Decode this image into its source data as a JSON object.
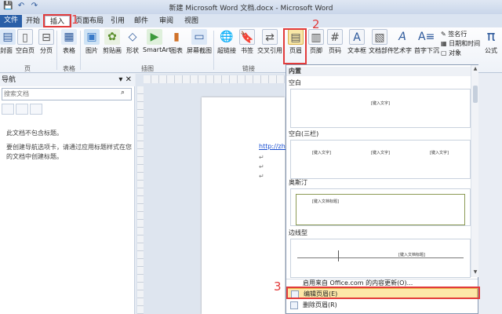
{
  "window": {
    "title": "新建 Microsoft Word 文档.docx - Microsoft Word"
  },
  "qat": [
    "💾",
    "↶",
    "↷"
  ],
  "tabs": [
    {
      "label": "文件"
    },
    {
      "label": "开始"
    },
    {
      "label": "插入"
    },
    {
      "label": "页面布局"
    },
    {
      "label": "引用"
    },
    {
      "label": "邮件"
    },
    {
      "label": "审阅"
    },
    {
      "label": "视图"
    }
  ],
  "ribbon": {
    "buttons": {
      "cover": "封面",
      "blank_page": "空白页",
      "page_break": "分页",
      "table": "表格",
      "picture": "图片",
      "clip_art": "剪贴画",
      "shapes": "形状",
      "smartart": "SmartArt",
      "chart": "图表",
      "screenshot": "屏幕截图",
      "hyperlink": "超链接",
      "bookmark": "书签",
      "cross_ref": "交叉引用",
      "header": "页眉",
      "footer": "页脚",
      "page_number": "页码",
      "textbox": "文本框",
      "quick_parts": "文档部件",
      "wordart": "艺术字",
      "drop_cap": "首字下沉",
      "signature": "签名行",
      "datetime": "日期和时间",
      "object": "对象",
      "equation": "公式"
    },
    "groups": {
      "pages": "页",
      "tables": "表格",
      "illustrations": "插图",
      "links": "链接"
    }
  },
  "nav_pane": {
    "title": "导航",
    "search_placeholder": "搜索文档",
    "msg1": "此文档不包含标题。",
    "msg2": "要创建导航选项卡，请通过应用标题样式在您的文档中创建标题。"
  },
  "document": {
    "link": "http://zhid"
  },
  "gallery": {
    "section": "内置",
    "items": [
      {
        "name": "空白",
        "placeholder": "[键入文字]"
      },
      {
        "name": "空白(三栏)",
        "placeholder": "[键入文字]"
      },
      {
        "name": "奥斯汀",
        "placeholder": "[键入文档标题]"
      },
      {
        "name": "边线型",
        "placeholder": "[键入文档标题]"
      }
    ],
    "menu": {
      "office_more": "启用来自 Office.com 的内容更新(O)...",
      "edit_header": "编辑页眉(E)",
      "remove_header": "删除页眉(R)"
    }
  },
  "steps": {
    "one": "1",
    "two": "2",
    "three": "3"
  }
}
